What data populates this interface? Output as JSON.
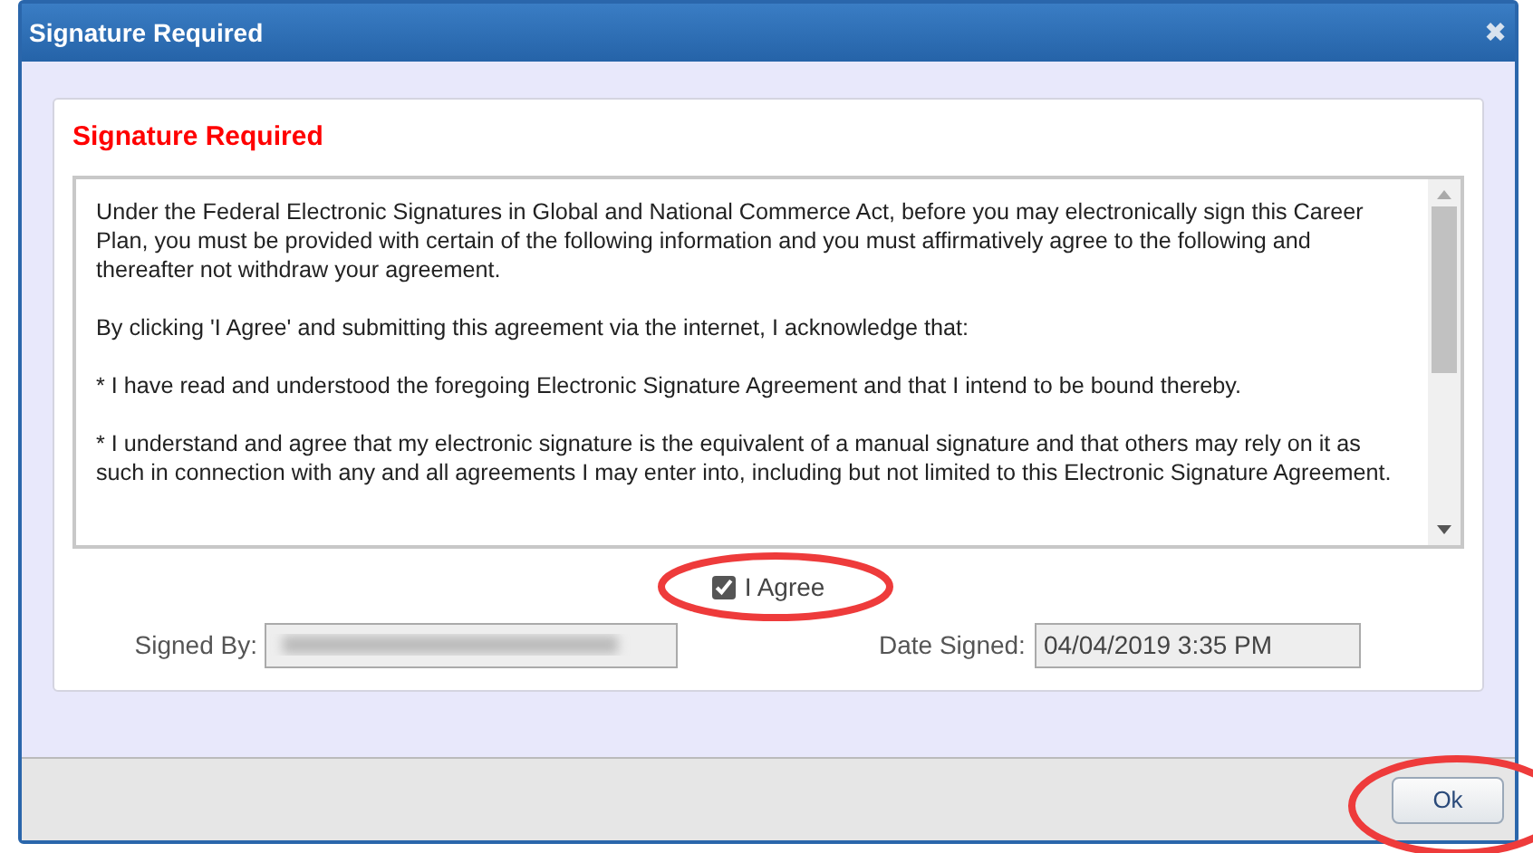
{
  "window": {
    "title": "Signature Required",
    "close": "✖"
  },
  "heading": "Signature Required",
  "agreement": [
    "Under the Federal Electronic Signatures in Global and National Commerce Act, before you may electronically sign this Career Plan, you must be provided with certain of the following information and you must affirmatively agree to the following and thereafter not withdraw your agreement.",
    "By clicking 'I Agree' and submitting this agreement via the internet, I acknowledge that:",
    "* I have read and understood the foregoing Electronic Signature Agreement and that I intend to be bound thereby.",
    "* I understand and agree that my electronic signature is the equivalent of a manual signature and that others may rely on it as such in connection with any and all agreements I may enter into, including but not limited to this Electronic Signature Agreement."
  ],
  "agree": {
    "label": "I Agree",
    "checked": true
  },
  "signed_by": {
    "label": "Signed By:"
  },
  "date_signed": {
    "label": "Date Signed:",
    "value": "04/04/2019 3:35 PM"
  },
  "buttons": [
    "Ok"
  ]
}
